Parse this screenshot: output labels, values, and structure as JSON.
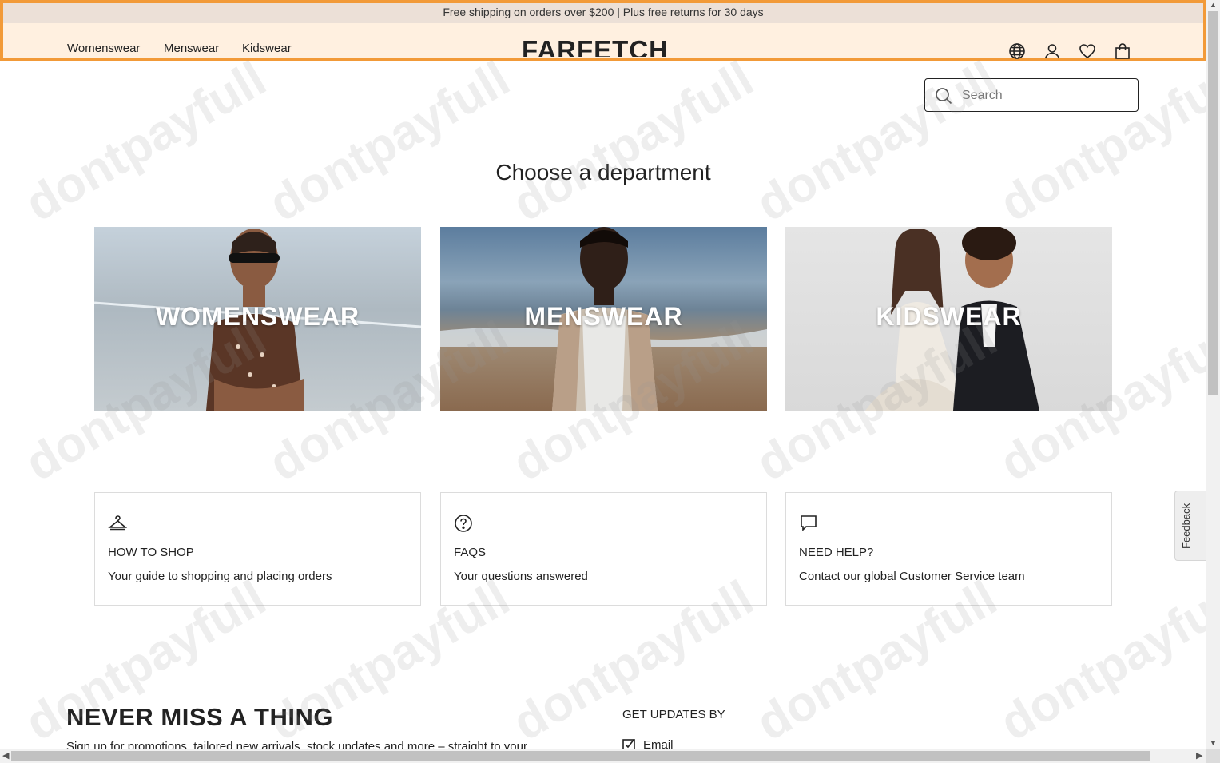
{
  "promo": {
    "text": "Free shipping on orders over $200 | Plus free returns for 30 days"
  },
  "nav": {
    "womenswear": "Womenswear",
    "menswear": "Menswear",
    "kidswear": "Kidswear"
  },
  "logo": "FARFETCH",
  "header_icons": [
    "globe-icon",
    "account-icon",
    "wishlist-heart-icon",
    "shopping-bag-icon"
  ],
  "search": {
    "placeholder": "Search",
    "value": ""
  },
  "departments": {
    "title": "Choose a department",
    "items": [
      {
        "label": "WOMENSWEAR"
      },
      {
        "label": "MENSWEAR"
      },
      {
        "label": "KIDSWEAR"
      }
    ]
  },
  "help": [
    {
      "icon": "hanger-icon",
      "title": "HOW TO SHOP",
      "desc": "Your guide to shopping and placing orders"
    },
    {
      "icon": "question-circle-icon",
      "title": "FAQS",
      "desc": "Your questions answered"
    },
    {
      "icon": "chat-bubble-icon",
      "title": "NEED HELP?",
      "desc": "Contact our global Customer Service team"
    }
  ],
  "newsletter": {
    "title": "NEVER MISS A THING",
    "text": "Sign up for promotions, tailored new arrivals, stock updates and more – straight to your",
    "updates_title": "GET UPDATES BY",
    "email_label": "Email",
    "email_checked": true
  },
  "feedback": "Feedback",
  "watermark": "dontpayfull",
  "colors": {
    "highlight_border": "#f29a38",
    "highlight_fill": "#fff0e0",
    "promo_bg": "#ece0d7"
  }
}
